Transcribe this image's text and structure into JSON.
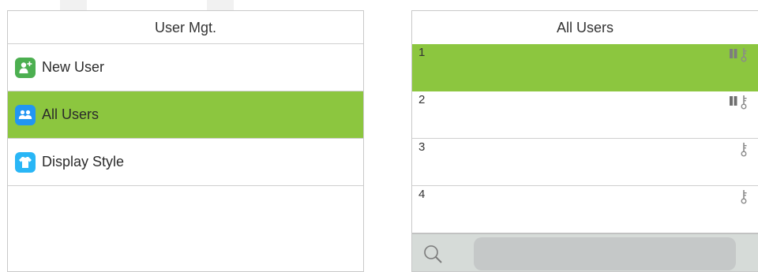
{
  "left_panel": {
    "title": "User Mgt.",
    "items": [
      {
        "label": "New User",
        "icon": "new-user-icon",
        "color": "#4caf50"
      },
      {
        "label": "All Users",
        "icon": "all-users-icon",
        "color": "#2196f3"
      },
      {
        "label": "Display Style",
        "icon": "display-style-icon",
        "color": "#29b6f6"
      }
    ],
    "selected_index": 1
  },
  "right_panel": {
    "title": "All Users",
    "users": [
      {
        "id": "1",
        "icons": [
          "card-icon",
          "password-icon"
        ]
      },
      {
        "id": "2",
        "icons": [
          "card-icon",
          "password-icon"
        ]
      },
      {
        "id": "3",
        "icons": [
          "password-icon"
        ]
      },
      {
        "id": "4",
        "icons": [
          "password-icon"
        ]
      }
    ],
    "selected_index": 0,
    "search": {
      "value": "",
      "placeholder": ""
    }
  },
  "colors": {
    "selected_row": "#8cc63f",
    "divider": "#cfcfcf",
    "search_bar": "#d6dbd8",
    "search_field": "#c5c8c8"
  }
}
